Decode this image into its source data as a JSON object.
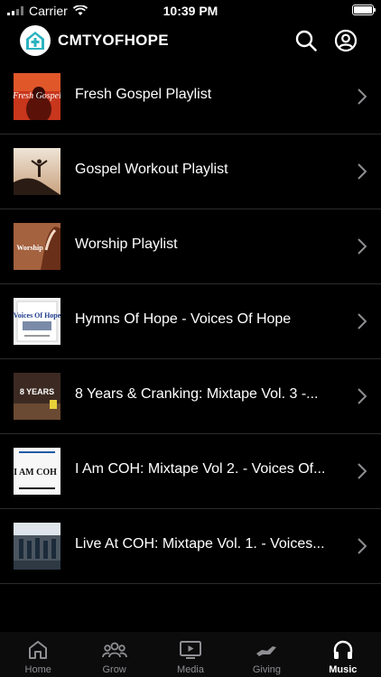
{
  "status_bar": {
    "carrier": "Carrier",
    "time": "10:39 PM"
  },
  "header": {
    "title": "CMTYOFHOPE"
  },
  "playlists": [
    {
      "title": "Fresh Gospel Playlist",
      "thumb_text": "Fresh Gospel"
    },
    {
      "title": "Gospel Workout Playlist"
    },
    {
      "title": "Worship Playlist",
      "thumb_text": "Worship"
    },
    {
      "title": "Hymns Of Hope  - Voices Of Hope",
      "thumb_text": "Voices Of Hope"
    },
    {
      "title": "8 Years & Cranking: Mixtape Vol. 3 -...",
      "thumb_text": "8 YEARS"
    },
    {
      "title": "I Am COH: Mixtape Vol 2. - Voices Of...",
      "thumb_text": "I AM COH"
    },
    {
      "title": "Live At COH: Mixtape Vol. 1. - Voices..."
    }
  ],
  "tabs": [
    {
      "label": "Home",
      "icon": "home-icon"
    },
    {
      "label": "Grow",
      "icon": "group-icon"
    },
    {
      "label": "Media",
      "icon": "play-screen-icon"
    },
    {
      "label": "Giving",
      "icon": "giving-hand-icon"
    },
    {
      "label": "Music",
      "icon": "headphones-icon"
    }
  ],
  "colors": {
    "background": "#000000",
    "inactive_tab": "#8e8e93",
    "logo_teal": "#2bb3c0"
  }
}
